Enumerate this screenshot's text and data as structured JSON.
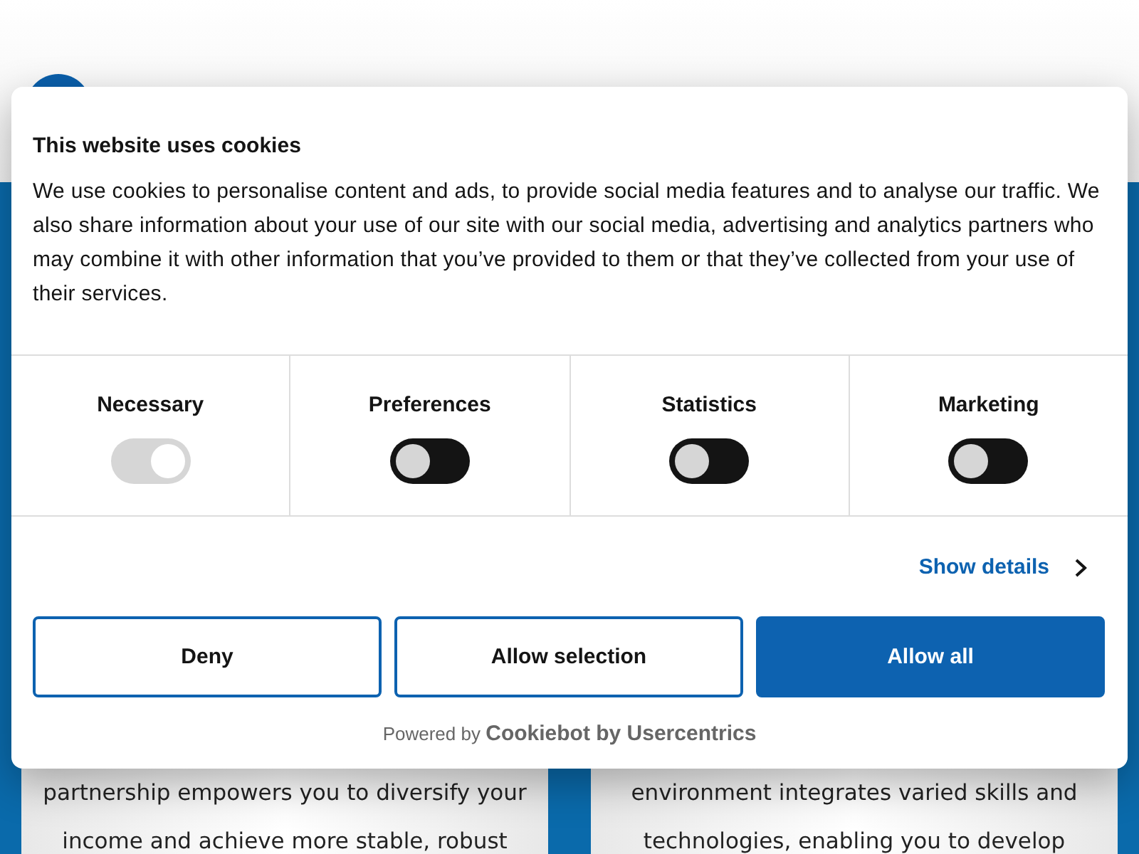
{
  "background_cards": [
    {
      "lines": [
        "partnership empowers you to diversify your",
        "income and achieve more stable, robust"
      ]
    },
    {
      "lines": [
        "environment integrates varied skills and",
        "technologies, enabling you to develop"
      ]
    }
  ],
  "dialog": {
    "title": "This website uses cookies",
    "body": "We use cookies to personalise content and ads, to provide social media features and to analyse our traffic. We also share information about your use of our site with our social media, advertising and analytics partners who may combine it with other information that you’ve provided to them or that they’ve collected from your use of their services.",
    "categories": [
      {
        "label": "Necessary",
        "checked": true,
        "disabled": true
      },
      {
        "label": "Preferences",
        "checked": false,
        "disabled": false
      },
      {
        "label": "Statistics",
        "checked": false,
        "disabled": false
      },
      {
        "label": "Marketing",
        "checked": false,
        "disabled": false
      }
    ],
    "show_details": "Show details",
    "buttons": [
      {
        "label": "Deny",
        "kind": "outline"
      },
      {
        "label": "Allow selection",
        "kind": "outline"
      },
      {
        "label": "Allow all",
        "kind": "primary"
      }
    ],
    "powered_by": "Powered by",
    "brand": "Cookiebot by Usercentrics"
  }
}
